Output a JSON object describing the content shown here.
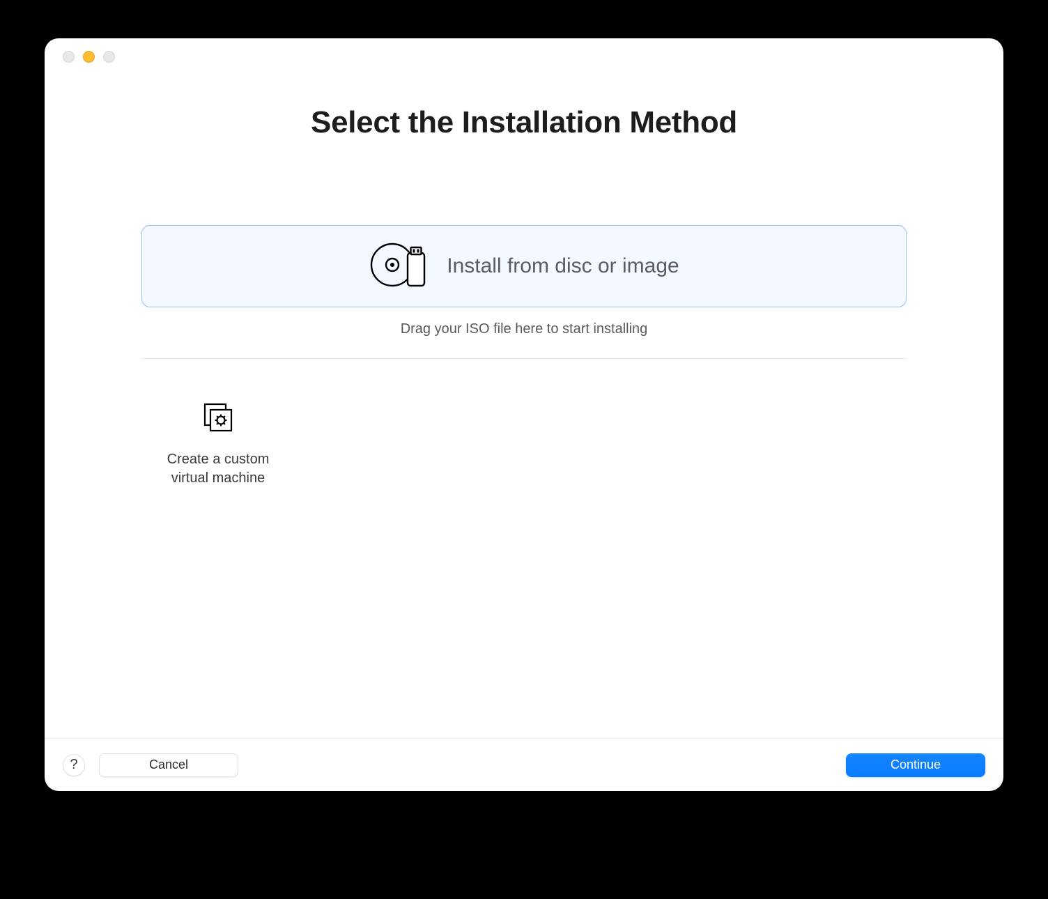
{
  "header": {
    "title": "Select the Installation Method"
  },
  "options": {
    "primary": {
      "label": "Install from disc or image",
      "hint": "Drag your ISO file here to start installing",
      "selected": true
    },
    "secondary": [
      {
        "label": "Create a custom\nvirtual machine"
      }
    ]
  },
  "footer": {
    "help_label": "?",
    "cancel_label": "Cancel",
    "continue_label": "Continue"
  },
  "window": {
    "traffic_lights": {
      "close_active": false,
      "minimize_active": true,
      "zoom_active": false
    }
  }
}
